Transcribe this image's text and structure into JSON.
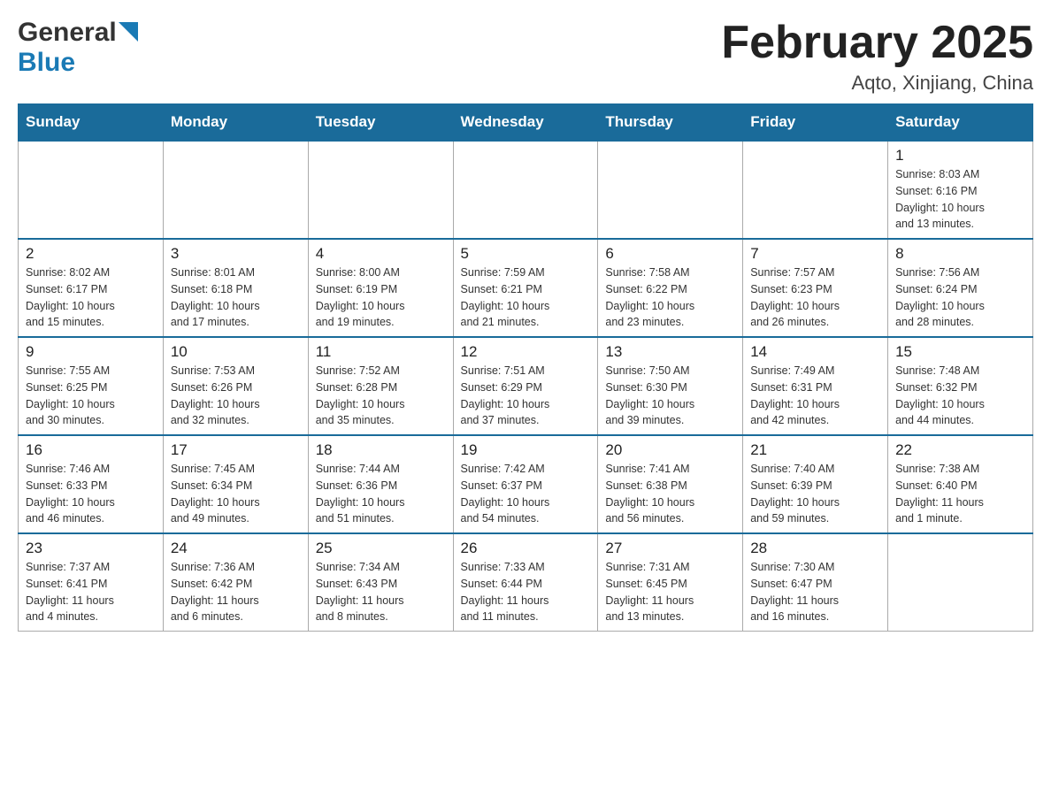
{
  "header": {
    "logo_general": "General",
    "logo_blue": "Blue",
    "month_year": "February 2025",
    "location": "Aqto, Xinjiang, China"
  },
  "weekdays": [
    "Sunday",
    "Monday",
    "Tuesday",
    "Wednesday",
    "Thursday",
    "Friday",
    "Saturday"
  ],
  "weeks": [
    [
      {
        "day": "",
        "info": ""
      },
      {
        "day": "",
        "info": ""
      },
      {
        "day": "",
        "info": ""
      },
      {
        "day": "",
        "info": ""
      },
      {
        "day": "",
        "info": ""
      },
      {
        "day": "",
        "info": ""
      },
      {
        "day": "1",
        "info": "Sunrise: 8:03 AM\nSunset: 6:16 PM\nDaylight: 10 hours\nand 13 minutes."
      }
    ],
    [
      {
        "day": "2",
        "info": "Sunrise: 8:02 AM\nSunset: 6:17 PM\nDaylight: 10 hours\nand 15 minutes."
      },
      {
        "day": "3",
        "info": "Sunrise: 8:01 AM\nSunset: 6:18 PM\nDaylight: 10 hours\nand 17 minutes."
      },
      {
        "day": "4",
        "info": "Sunrise: 8:00 AM\nSunset: 6:19 PM\nDaylight: 10 hours\nand 19 minutes."
      },
      {
        "day": "5",
        "info": "Sunrise: 7:59 AM\nSunset: 6:21 PM\nDaylight: 10 hours\nand 21 minutes."
      },
      {
        "day": "6",
        "info": "Sunrise: 7:58 AM\nSunset: 6:22 PM\nDaylight: 10 hours\nand 23 minutes."
      },
      {
        "day": "7",
        "info": "Sunrise: 7:57 AM\nSunset: 6:23 PM\nDaylight: 10 hours\nand 26 minutes."
      },
      {
        "day": "8",
        "info": "Sunrise: 7:56 AM\nSunset: 6:24 PM\nDaylight: 10 hours\nand 28 minutes."
      }
    ],
    [
      {
        "day": "9",
        "info": "Sunrise: 7:55 AM\nSunset: 6:25 PM\nDaylight: 10 hours\nand 30 minutes."
      },
      {
        "day": "10",
        "info": "Sunrise: 7:53 AM\nSunset: 6:26 PM\nDaylight: 10 hours\nand 32 minutes."
      },
      {
        "day": "11",
        "info": "Sunrise: 7:52 AM\nSunset: 6:28 PM\nDaylight: 10 hours\nand 35 minutes."
      },
      {
        "day": "12",
        "info": "Sunrise: 7:51 AM\nSunset: 6:29 PM\nDaylight: 10 hours\nand 37 minutes."
      },
      {
        "day": "13",
        "info": "Sunrise: 7:50 AM\nSunset: 6:30 PM\nDaylight: 10 hours\nand 39 minutes."
      },
      {
        "day": "14",
        "info": "Sunrise: 7:49 AM\nSunset: 6:31 PM\nDaylight: 10 hours\nand 42 minutes."
      },
      {
        "day": "15",
        "info": "Sunrise: 7:48 AM\nSunset: 6:32 PM\nDaylight: 10 hours\nand 44 minutes."
      }
    ],
    [
      {
        "day": "16",
        "info": "Sunrise: 7:46 AM\nSunset: 6:33 PM\nDaylight: 10 hours\nand 46 minutes."
      },
      {
        "day": "17",
        "info": "Sunrise: 7:45 AM\nSunset: 6:34 PM\nDaylight: 10 hours\nand 49 minutes."
      },
      {
        "day": "18",
        "info": "Sunrise: 7:44 AM\nSunset: 6:36 PM\nDaylight: 10 hours\nand 51 minutes."
      },
      {
        "day": "19",
        "info": "Sunrise: 7:42 AM\nSunset: 6:37 PM\nDaylight: 10 hours\nand 54 minutes."
      },
      {
        "day": "20",
        "info": "Sunrise: 7:41 AM\nSunset: 6:38 PM\nDaylight: 10 hours\nand 56 minutes."
      },
      {
        "day": "21",
        "info": "Sunrise: 7:40 AM\nSunset: 6:39 PM\nDaylight: 10 hours\nand 59 minutes."
      },
      {
        "day": "22",
        "info": "Sunrise: 7:38 AM\nSunset: 6:40 PM\nDaylight: 11 hours\nand 1 minute."
      }
    ],
    [
      {
        "day": "23",
        "info": "Sunrise: 7:37 AM\nSunset: 6:41 PM\nDaylight: 11 hours\nand 4 minutes."
      },
      {
        "day": "24",
        "info": "Sunrise: 7:36 AM\nSunset: 6:42 PM\nDaylight: 11 hours\nand 6 minutes."
      },
      {
        "day": "25",
        "info": "Sunrise: 7:34 AM\nSunset: 6:43 PM\nDaylight: 11 hours\nand 8 minutes."
      },
      {
        "day": "26",
        "info": "Sunrise: 7:33 AM\nSunset: 6:44 PM\nDaylight: 11 hours\nand 11 minutes."
      },
      {
        "day": "27",
        "info": "Sunrise: 7:31 AM\nSunset: 6:45 PM\nDaylight: 11 hours\nand 13 minutes."
      },
      {
        "day": "28",
        "info": "Sunrise: 7:30 AM\nSunset: 6:47 PM\nDaylight: 11 hours\nand 16 minutes."
      },
      {
        "day": "",
        "info": ""
      }
    ]
  ]
}
